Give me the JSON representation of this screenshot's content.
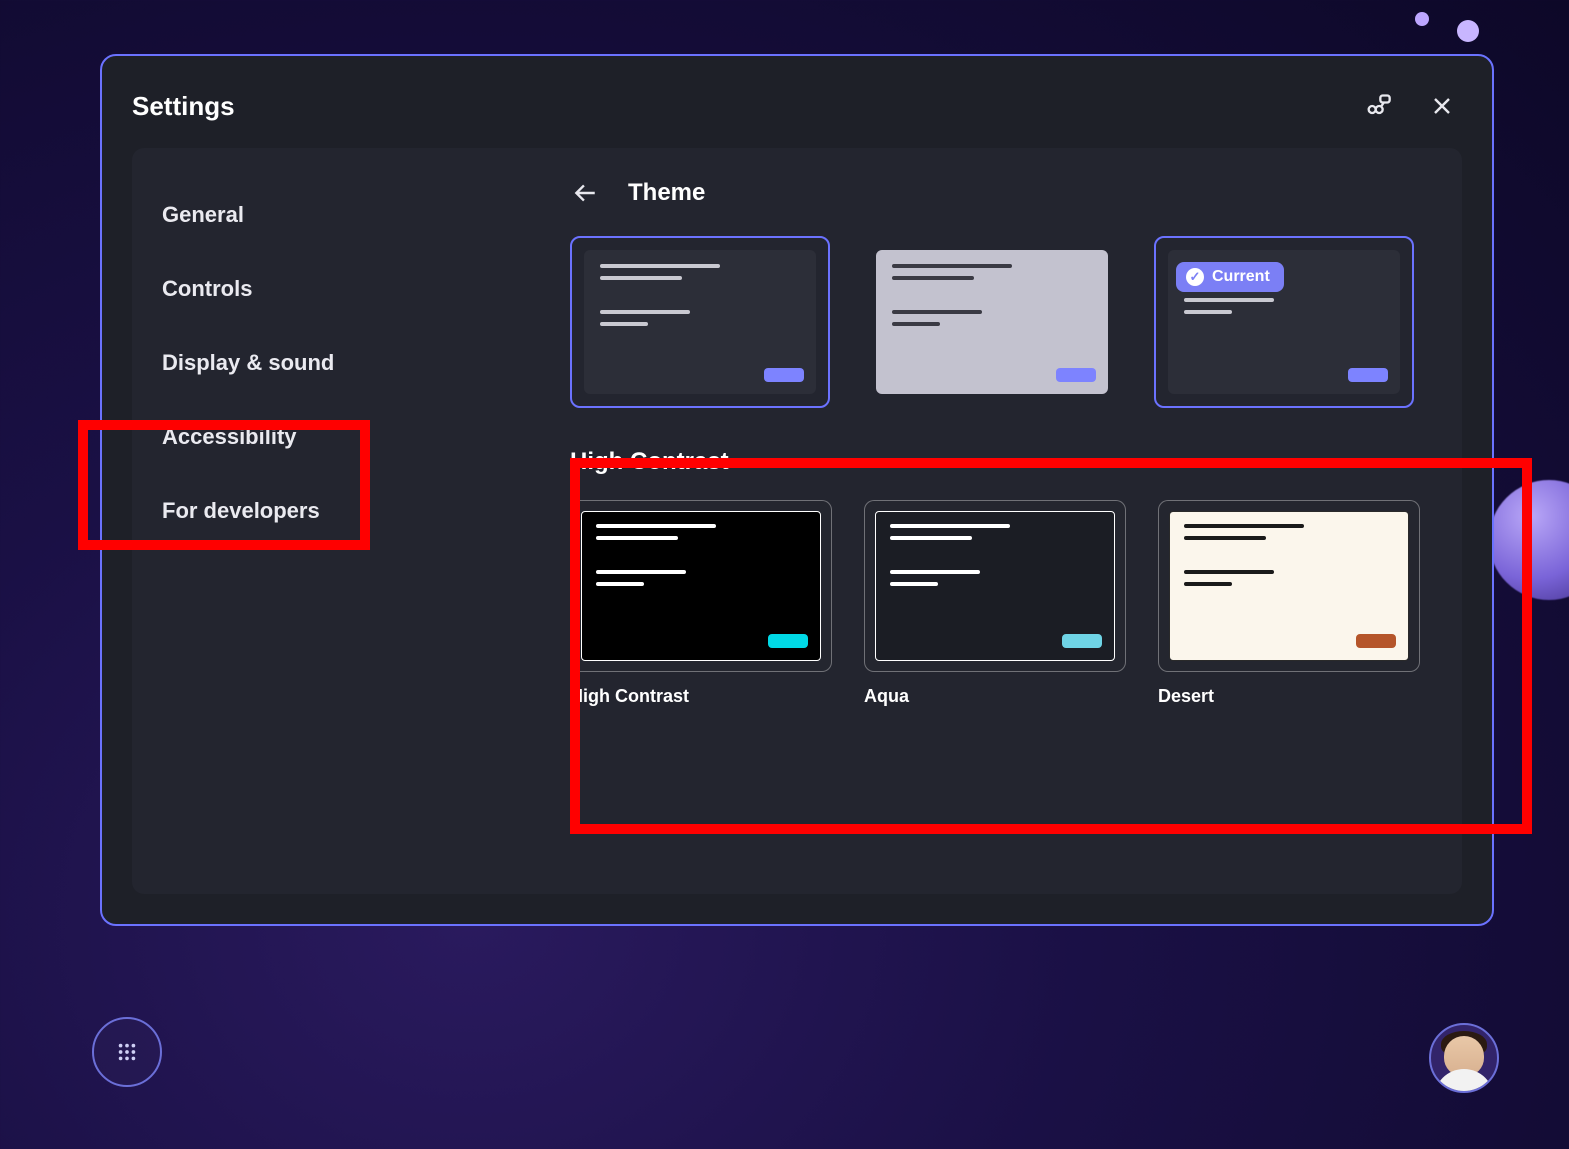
{
  "header": {
    "title": "Settings"
  },
  "sidebar": {
    "items": [
      {
        "label": "General"
      },
      {
        "label": "Controls"
      },
      {
        "label": "Display & sound"
      },
      {
        "label": "Accessibility"
      },
      {
        "label": "For developers"
      }
    ]
  },
  "content": {
    "title": "Theme",
    "current_badge": "Current",
    "themes": {
      "standard": [
        {
          "bg": "#2c2e38",
          "line": "#c9c9d1",
          "accent": "#7d83ff",
          "selected": true,
          "current": false
        },
        {
          "bg": "#c3c2cf",
          "line": "#3a3a44",
          "accent": "#7d83ff",
          "selected": false,
          "current": false
        },
        {
          "bg": "#2c2e38",
          "line": "#c9c9d1",
          "accent": "#7d83ff",
          "selected": false,
          "current": true
        }
      ]
    },
    "high_contrast": {
      "title": "High Contrast",
      "items": [
        {
          "label": "High Contrast",
          "bg": "#000000",
          "line": "#ffffff",
          "border": "#ffffff",
          "accent": "#00d9e6"
        },
        {
          "label": "Aqua",
          "bg": "#1b1d24",
          "line": "#ffffff",
          "border": "#ffffff",
          "accent": "#6fd4e6"
        },
        {
          "label": "Desert",
          "bg": "#fbf6ec",
          "line": "#1a1a1a",
          "border": "#2a2a2a",
          "accent": "#b5552a"
        }
      ]
    }
  }
}
